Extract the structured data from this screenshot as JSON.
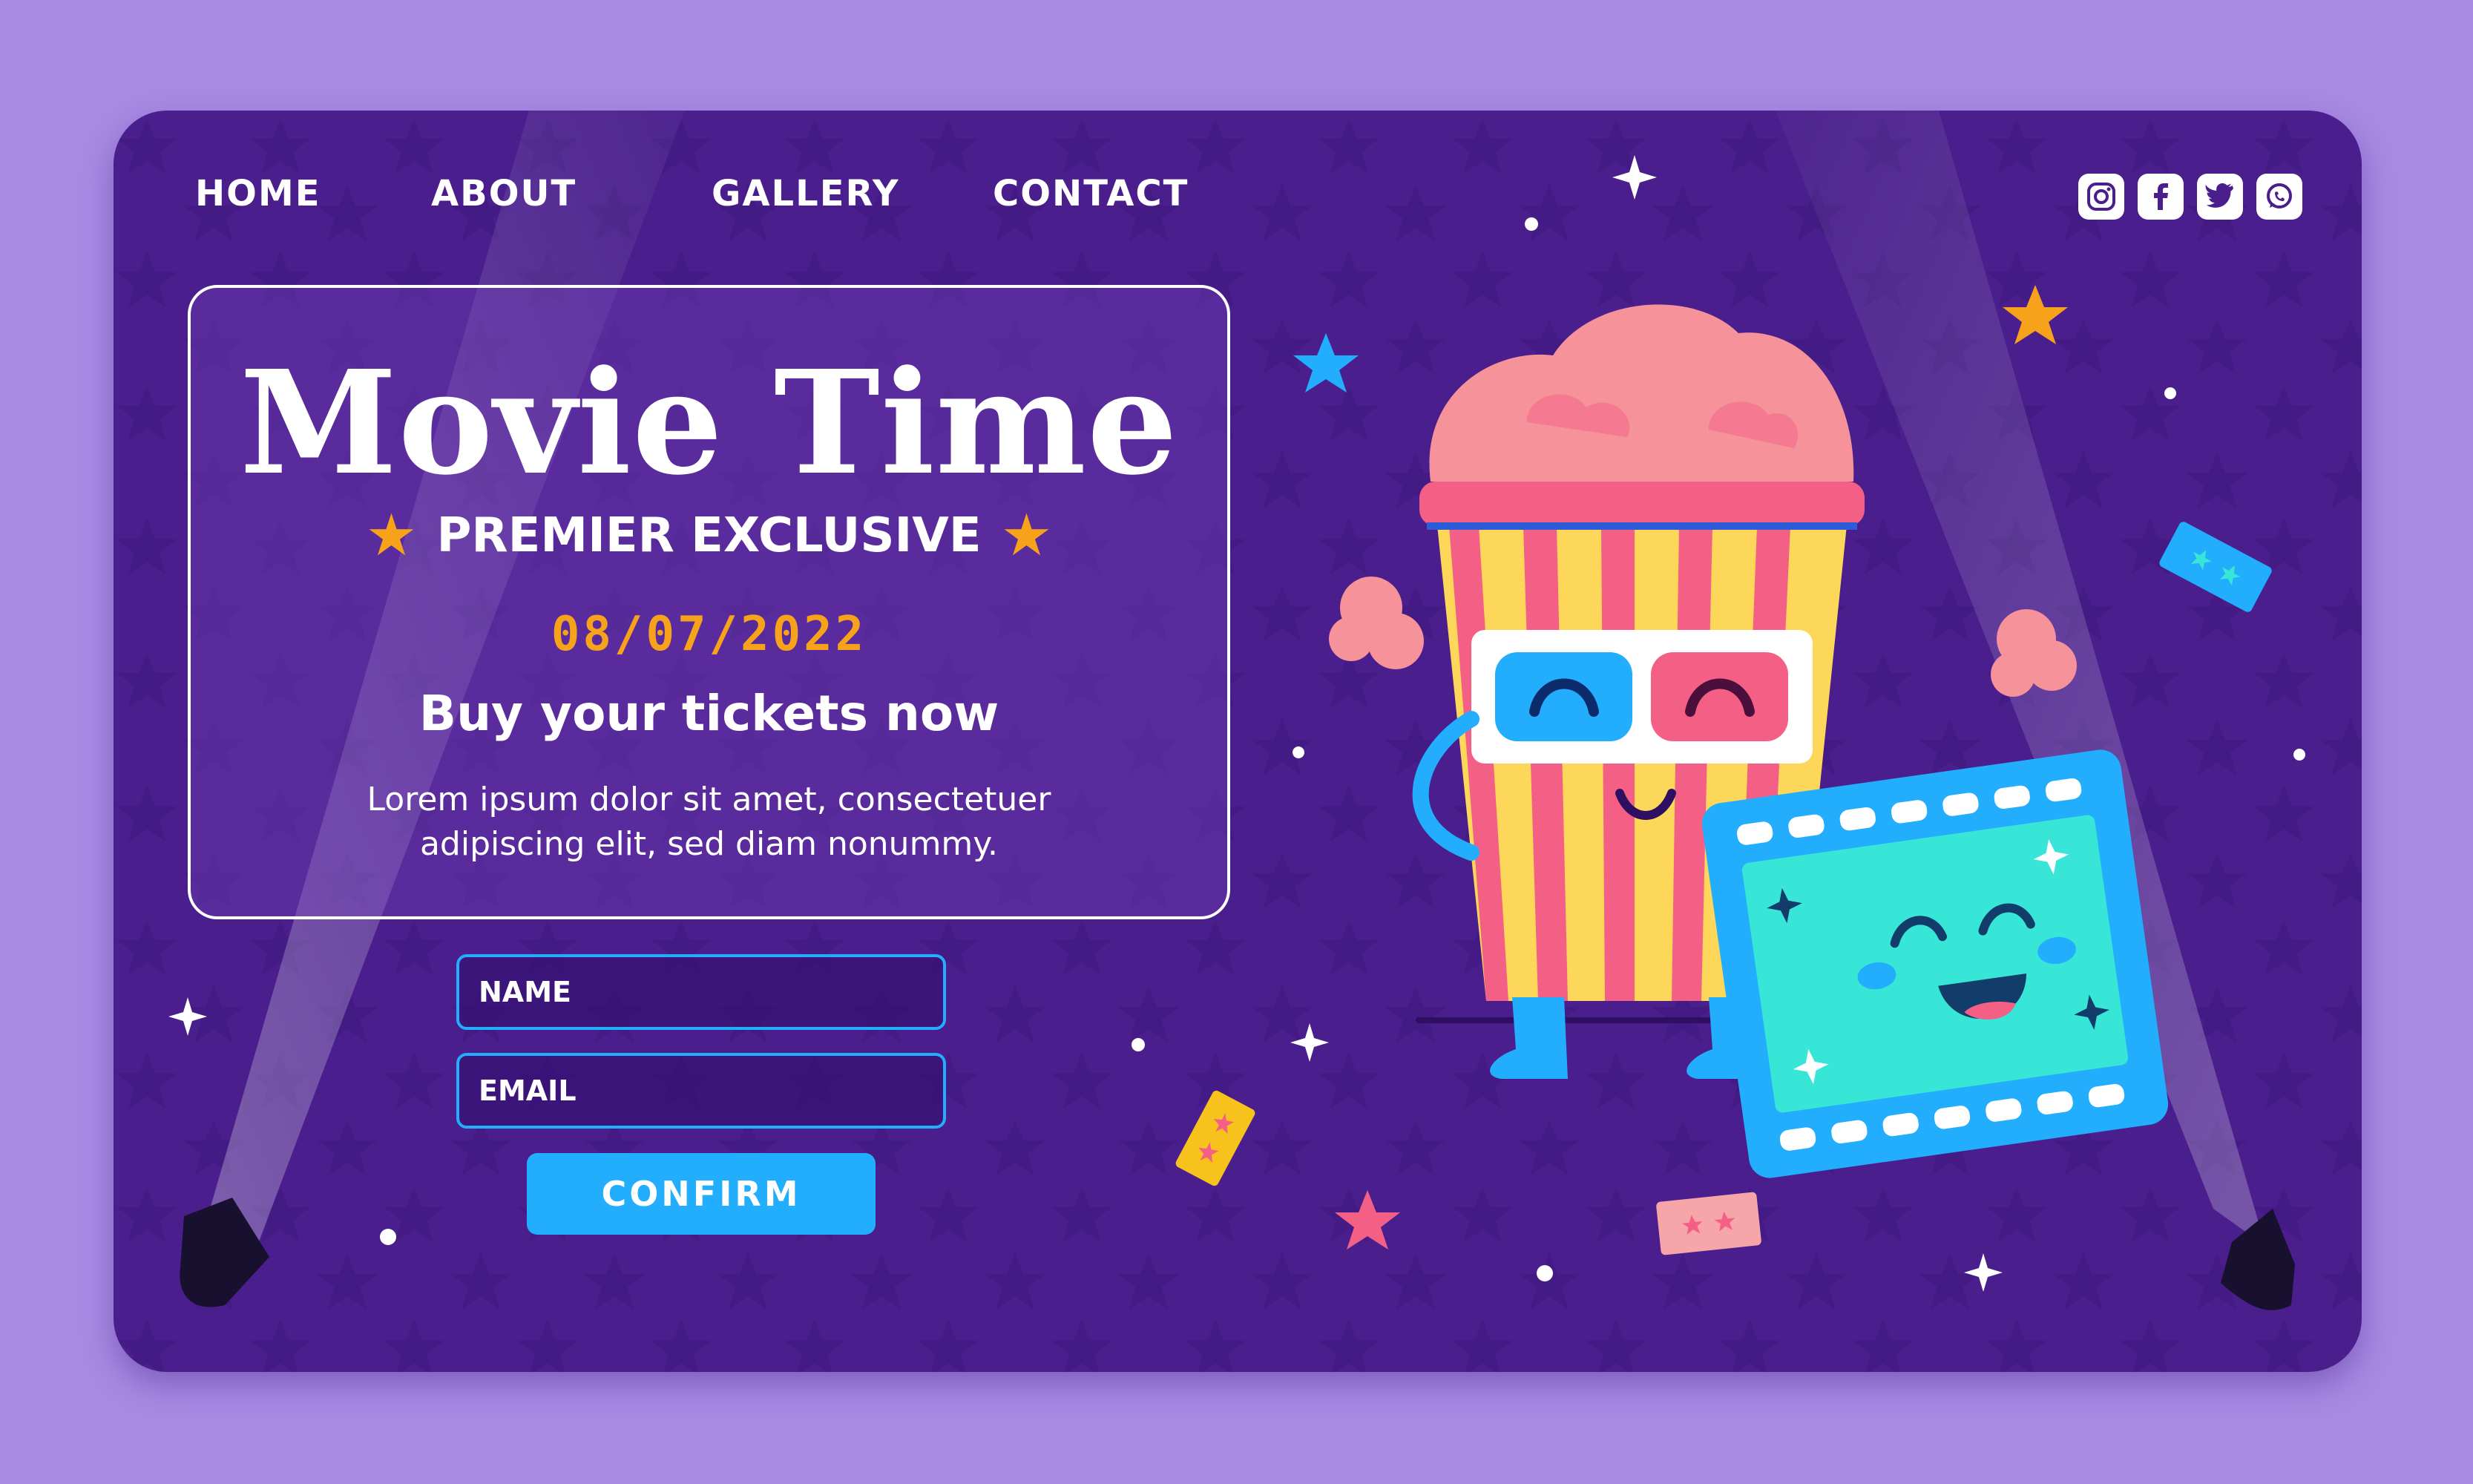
{
  "nav": {
    "items": [
      {
        "label": "HOME"
      },
      {
        "label": "ABOUT"
      },
      {
        "label": "GALLERY"
      },
      {
        "label": "CONTACT"
      }
    ]
  },
  "social": [
    "instagram-icon",
    "facebook-icon",
    "twitter-icon",
    "whatsapp-icon"
  ],
  "hero": {
    "title": "Movie Time",
    "subtitle": "PREMIER EXCLUSIVE",
    "date": "08/07/2022",
    "cta_text": "Buy your tickets now",
    "body": "Lorem ipsum dolor sit amet, consectetuer adipiscing elit, sed diam nonummy."
  },
  "form": {
    "name_placeholder": "NAME",
    "email_placeholder": "EMAIL",
    "confirm_label": "CONFIRM"
  },
  "colors": {
    "background": "#a78ae4",
    "card": "#4a1e8c",
    "accent_orange": "#f7a21b",
    "accent_blue": "#22aefc",
    "popcorn_pink": "#f6929a"
  }
}
